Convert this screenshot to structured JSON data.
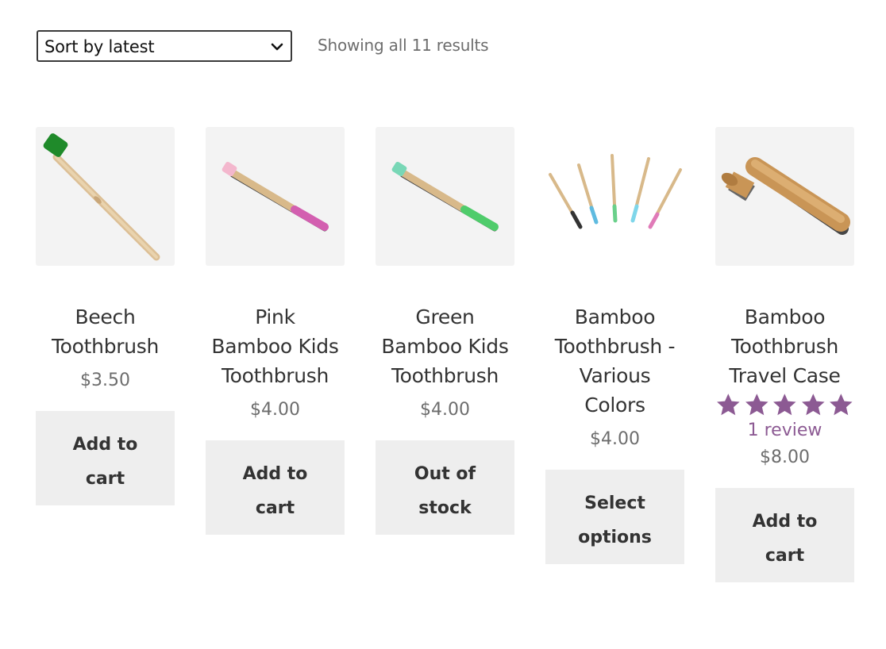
{
  "toolbar": {
    "sort_selected": "Sort by latest",
    "result_count": "Showing all 11 results"
  },
  "colors": {
    "star": "#8c5a93",
    "review_link": "#8c5a93",
    "button_bg": "#eeeeee",
    "thumb_bg": "#f3f3f3"
  },
  "products": [
    {
      "title_lines": [
        "Beech",
        "Toothbrush"
      ],
      "price": "$3.50",
      "button_lines": [
        "Add to",
        "cart"
      ]
    },
    {
      "title_lines": [
        "Pink",
        "Bamboo Kids",
        "Toothbrush"
      ],
      "price": "$4.00",
      "button_lines": [
        "Add to",
        "cart"
      ]
    },
    {
      "title_lines": [
        "Green",
        "Bamboo Kids",
        "Toothbrush"
      ],
      "price": "$4.00",
      "button_lines": [
        "Out of",
        "stock"
      ]
    },
    {
      "title_lines": [
        "Bamboo",
        "Toothbrush -",
        "Various",
        "Colors"
      ],
      "price": "$4.00",
      "button_lines": [
        "Select",
        "options"
      ]
    },
    {
      "title_lines": [
        "Bamboo",
        "Toothbrush",
        "Travel Case"
      ],
      "rating": 5,
      "rating_max": 5,
      "review_text": "1 review",
      "price": "$8.00",
      "button_lines": [
        "Add to",
        "cart"
      ]
    }
  ]
}
